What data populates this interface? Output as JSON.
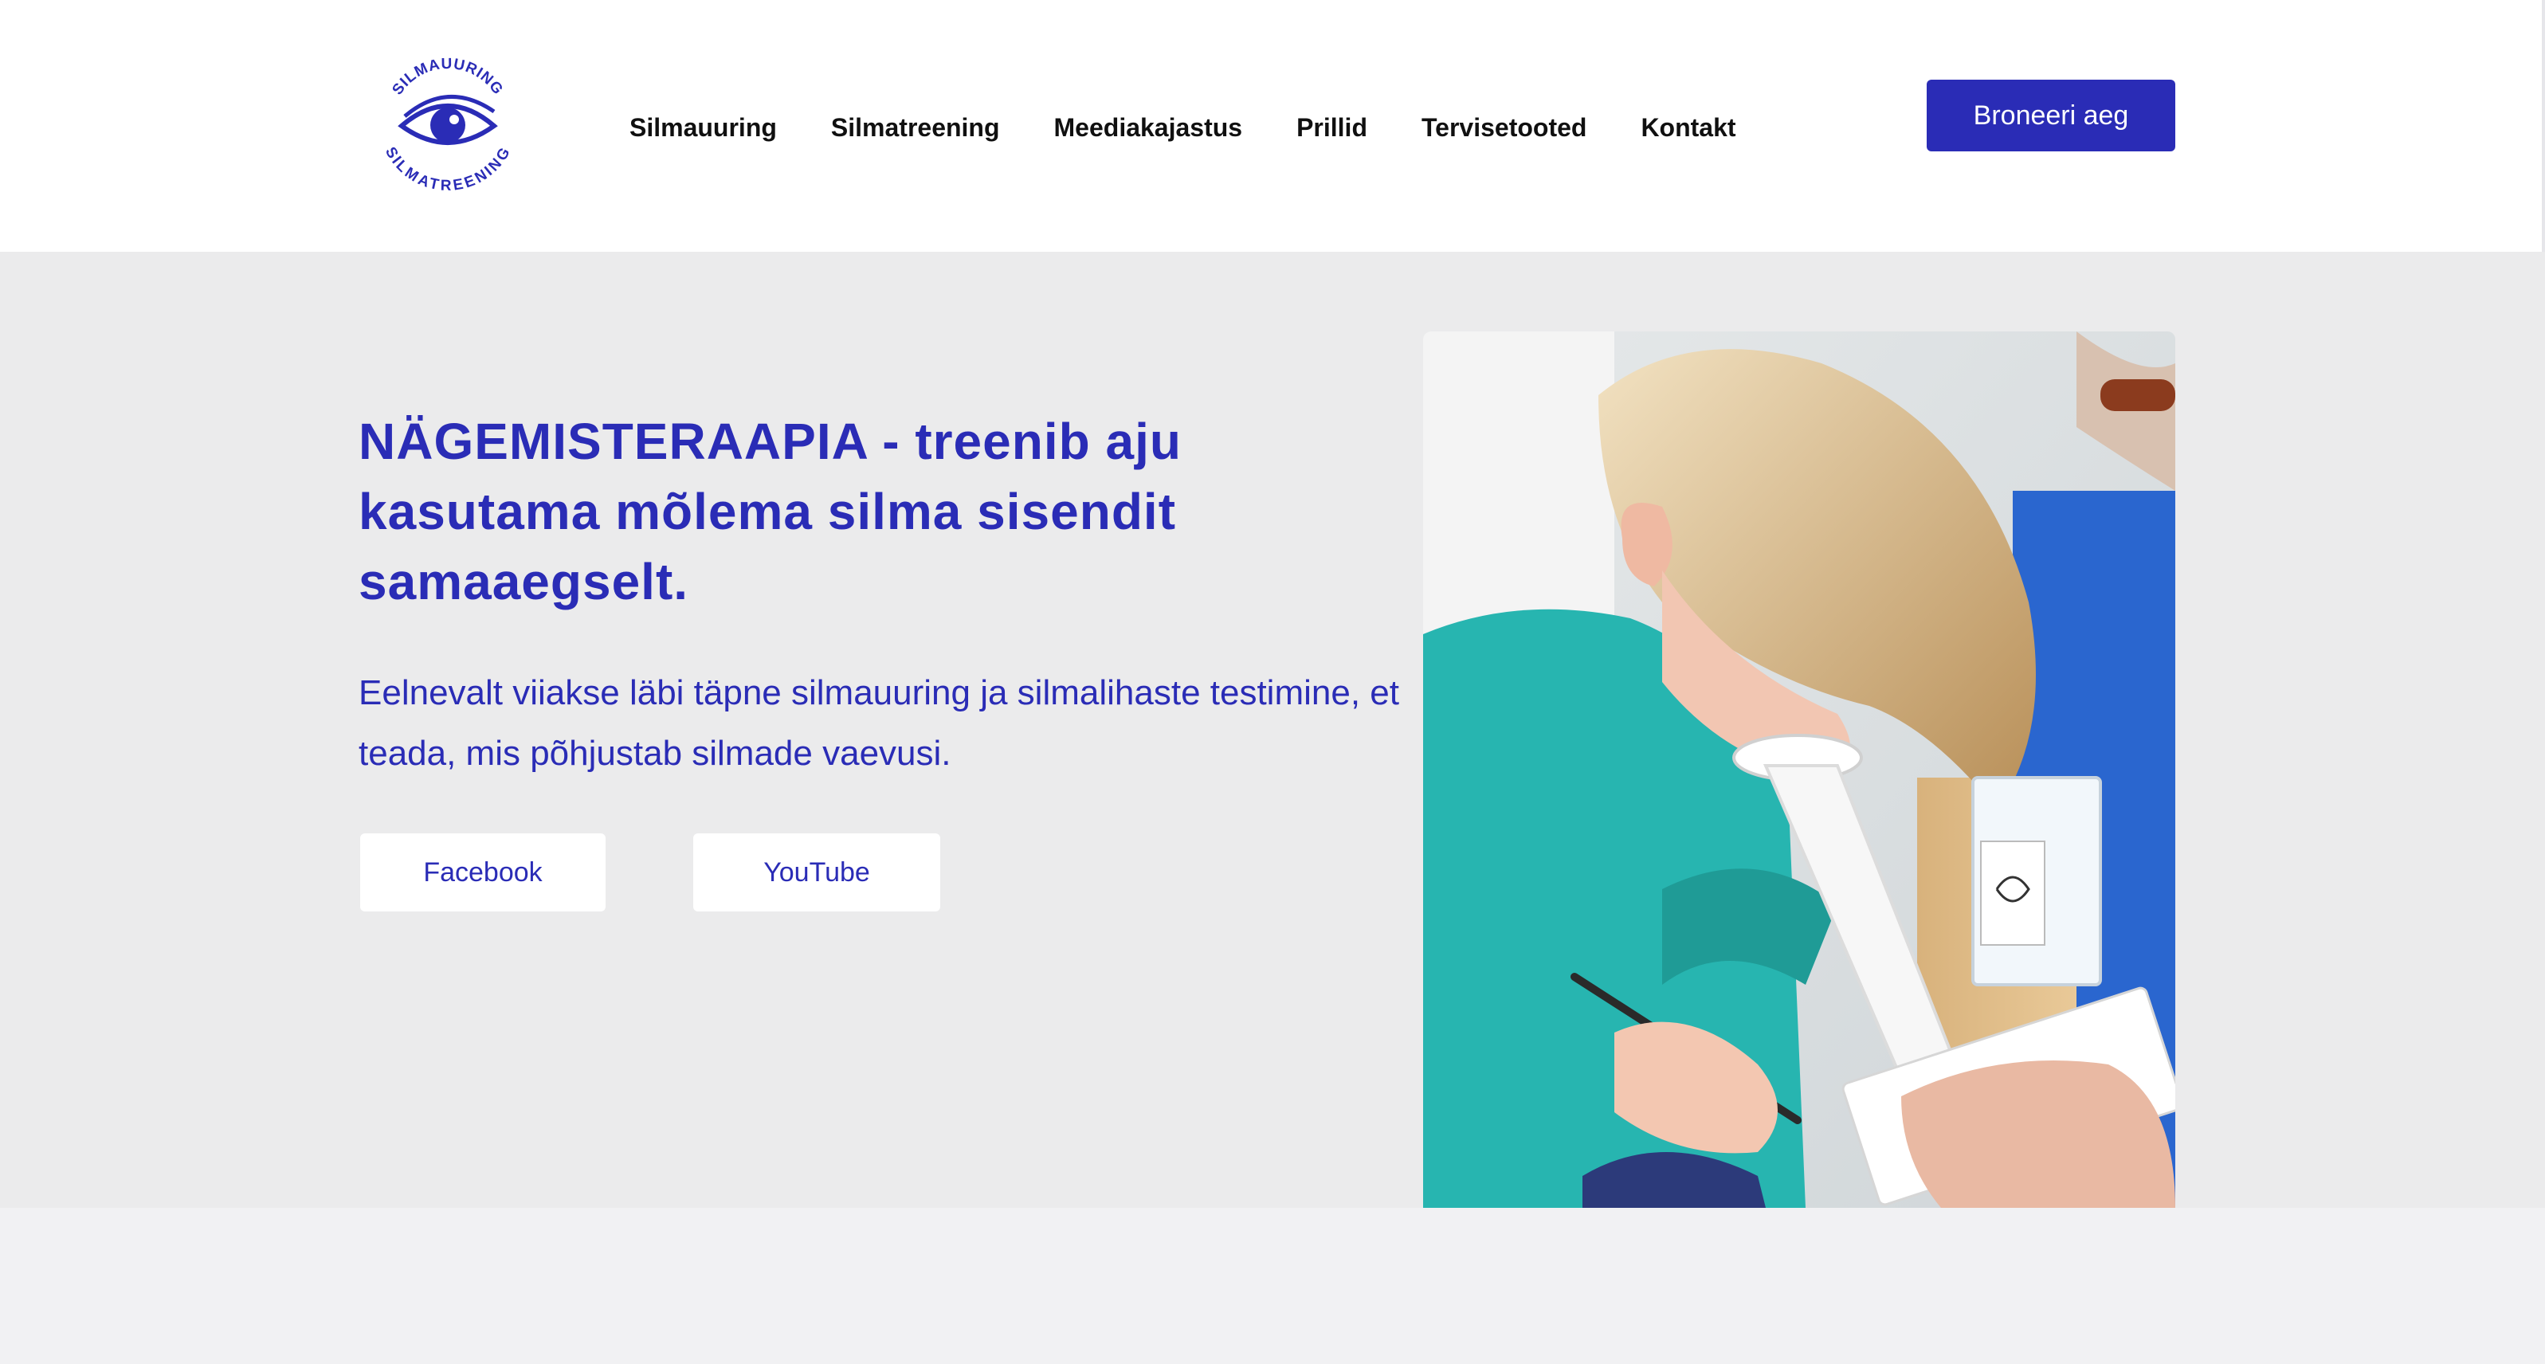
{
  "logo": {
    "top_text": "SILMAUURING",
    "bottom_text": "SILMATREENING",
    "icon": "eye-icon",
    "color": "#2a2cb6"
  },
  "nav": {
    "items": [
      {
        "label": "Silmauuring"
      },
      {
        "label": "Silmatreening"
      },
      {
        "label": "Meediakajastus"
      },
      {
        "label": "Prillid"
      },
      {
        "label": "Tervisetooted"
      },
      {
        "label": "Kontakt"
      }
    ]
  },
  "header": {
    "book_label": "Broneeri aeg"
  },
  "hero": {
    "title": "NÄGEMISTERAAPIA - treenib aju kasutama mõlema silma sisendit samaaegselt.",
    "text": "Eelnevalt viiakse läbi täpne silmauuring ja silmalihaste testimine, et teada, mis põhjustab silmade vaevusi.",
    "facebook_label": "Facebook",
    "youtube_label": "YouTube"
  },
  "colors": {
    "brand": "#2a2cb6",
    "hero_bg": "#ebebec",
    "page_bg": "#f1f1f3"
  }
}
